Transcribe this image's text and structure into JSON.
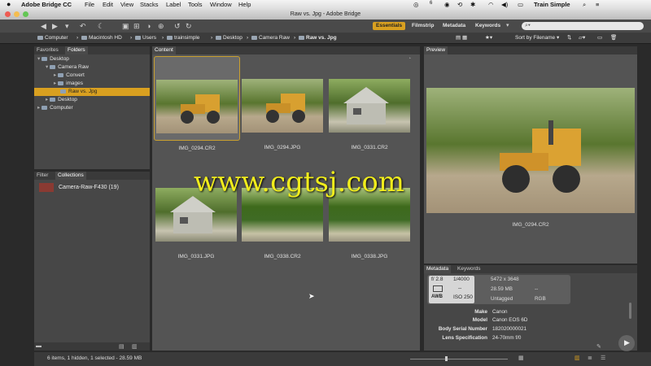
{
  "menubar": {
    "app_name": "Adobe Bridge CC",
    "items": [
      "File",
      "Edit",
      "View",
      "Stacks",
      "Label",
      "Tools",
      "Window",
      "Help"
    ],
    "status_right": "Train Simple",
    "badge": "6"
  },
  "window": {
    "title": "Raw vs. Jpg - Adobe Bridge"
  },
  "toolbar": {
    "workspaces": [
      "Essentials",
      "Filmstrip",
      "Metadata",
      "Keywords"
    ],
    "search_placeholder": ""
  },
  "pathbar": {
    "crumbs": [
      "Computer",
      "Macintosh HD",
      "Users",
      "trainsimple",
      "Desktop",
      "Camera Raw",
      "Raw vs. Jpg"
    ],
    "sort_label": "Sort by Filename"
  },
  "favorites_panel": {
    "tabs": [
      "Favorites",
      "Folders"
    ],
    "tree": [
      "Desktop",
      "Camera Raw",
      "Convert",
      "images",
      "Raw vs. Jpg",
      "Desktop",
      "Computer"
    ]
  },
  "collections_panel": {
    "tabs": [
      "Filter",
      "Collections"
    ],
    "items": [
      {
        "label": "Camera-Raw-F430 (19)"
      }
    ]
  },
  "content_panel": {
    "tab": "Content",
    "thumbnails": [
      {
        "name": "IMG_0294.CR2",
        "scene": "loader",
        "selected": true
      },
      {
        "name": "IMG_0294.JPG",
        "scene": "loader",
        "selected": false
      },
      {
        "name": "IMG_0331.CR2",
        "scene": "barn",
        "selected": false
      },
      {
        "name": "IMG_0331.JPG",
        "scene": "barn",
        "selected": false
      },
      {
        "name": "IMG_0338.CR2",
        "scene": "road",
        "selected": false
      },
      {
        "name": "IMG_0338.JPG",
        "scene": "road",
        "selected": false
      }
    ]
  },
  "preview_panel": {
    "tab": "Preview",
    "filename": "IMG_0294.CR2"
  },
  "metadata_panel": {
    "tabs": [
      "Metadata",
      "Keywords"
    ],
    "placard": {
      "aperture": "f/ 2.8",
      "shutter": "1/4000",
      "dash1": "--",
      "iso": "ISO 250",
      "dimensions": "5472 x 3648",
      "size": "28.59 MB",
      "dash2": "--",
      "label": "Untagged",
      "color_mode": "RGB"
    },
    "fields": [
      {
        "key": "Make",
        "value": "Canon"
      },
      {
        "key": "Model",
        "value": "Canon EOS 6D"
      },
      {
        "key": "Body Serial Number",
        "value": "182020000021"
      },
      {
        "key": "Lens Specification",
        "value": "24-70mm f/0"
      }
    ]
  },
  "statusbar": {
    "text": "6 items, 1 hidden, 1 selected - 28.59 MB"
  },
  "watermark": {
    "text": "www.cgtsj.com"
  },
  "colors": {
    "accent": "#d9a020",
    "watermark": "#f0ec1c"
  }
}
